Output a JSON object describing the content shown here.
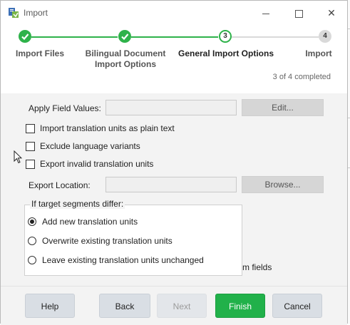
{
  "window": {
    "title": "Import"
  },
  "stepper": {
    "steps": [
      {
        "number": "",
        "label": "Import Files",
        "state": "done"
      },
      {
        "number": "",
        "label": "Bilingual Document\nImport Options",
        "state": "done"
      },
      {
        "number": "3",
        "label": "General Import Options",
        "state": "current"
      },
      {
        "number": "4",
        "label": "Import",
        "state": "todo"
      }
    ],
    "progress": "3 of 4 completed"
  },
  "form": {
    "apply_field_values_label": "Apply Field Values:",
    "apply_field_values_value": "",
    "edit_button": "Edit...",
    "checkboxes": [
      {
        "label": "Import translation units as plain text",
        "checked": false
      },
      {
        "label": "Exclude language variants",
        "checked": false
      },
      {
        "label": "Export invalid translation units",
        "checked": false
      }
    ],
    "export_location_label": "Export Location:",
    "export_location_value": "",
    "browse_button": "Browse...",
    "target_group": {
      "title": "If target segments differ:",
      "options": [
        {
          "label": "Add new translation units",
          "selected": true
        },
        {
          "label": "Overwrite existing translation units",
          "selected": false
        },
        {
          "label": "Leave existing translation units unchanged",
          "selected": false
        }
      ]
    },
    "partial_text": "m fields"
  },
  "footer": {
    "help": "Help",
    "back": "Back",
    "next": "Next",
    "finish": "Finish",
    "cancel": "Cancel"
  },
  "colors": {
    "accent": "#2eb24a",
    "finish_button": "#21b14a",
    "footer_button": "#d9dee4"
  },
  "icons": {
    "app": "import-app-icon",
    "check": "checkmark-icon",
    "cursor": "mouse-pointer-icon"
  }
}
